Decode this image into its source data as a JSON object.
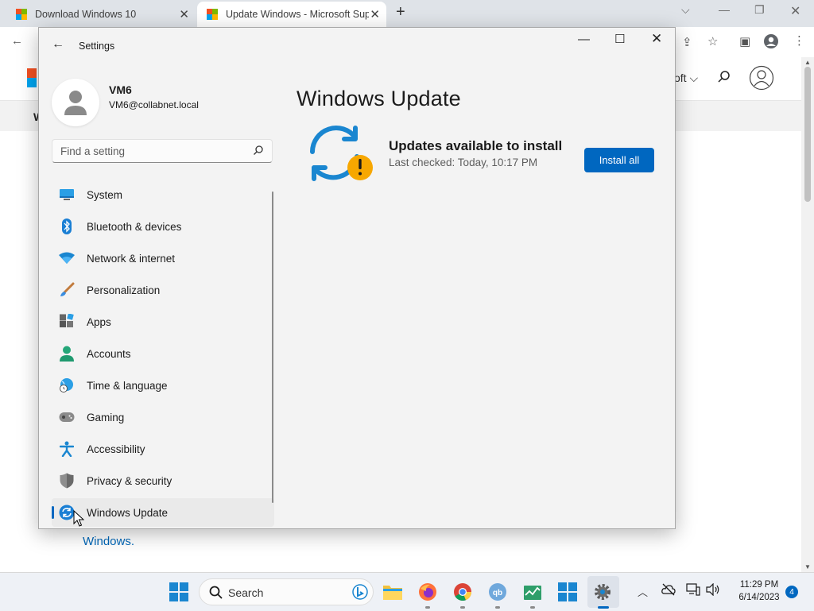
{
  "browser": {
    "tabs": [
      {
        "title": "Download Windows 10"
      },
      {
        "title": "Update Windows - Microsoft Support"
      }
    ],
    "header_partial_text": "oft",
    "subnav_partial_text": "W"
  },
  "settings": {
    "window_title": "Settings",
    "user": {
      "name": "VM6",
      "email": "VM6@collabnet.local"
    },
    "search_placeholder": "Find a setting",
    "nav": [
      {
        "label": "System",
        "icon": "monitor-icon"
      },
      {
        "label": "Bluetooth & devices",
        "icon": "bluetooth-icon"
      },
      {
        "label": "Network & internet",
        "icon": "wifi-icon"
      },
      {
        "label": "Personalization",
        "icon": "paintbrush-icon"
      },
      {
        "label": "Apps",
        "icon": "apps-icon"
      },
      {
        "label": "Accounts",
        "icon": "person-icon"
      },
      {
        "label": "Time & language",
        "icon": "globe-clock-icon"
      },
      {
        "label": "Gaming",
        "icon": "gamepad-icon"
      },
      {
        "label": "Accessibility",
        "icon": "accessibility-icon"
      },
      {
        "label": "Privacy & security",
        "icon": "shield-icon"
      },
      {
        "label": "Windows Update",
        "icon": "update-icon",
        "selected": true
      }
    ],
    "page_title": "Windows Update",
    "status": {
      "heading": "Updates available to install",
      "last_checked": "Last checked: Today, 10:17 PM"
    },
    "install_button": "Install all"
  },
  "page": {
    "link_text": "Windows."
  },
  "taskbar": {
    "search_label": "Search",
    "time": "11:29 PM",
    "date": "6/14/2023",
    "notification_count": "4"
  },
  "colors": {
    "accent": "#0067c0",
    "warning": "#f7a700",
    "update_blue": "#1a86d0"
  }
}
